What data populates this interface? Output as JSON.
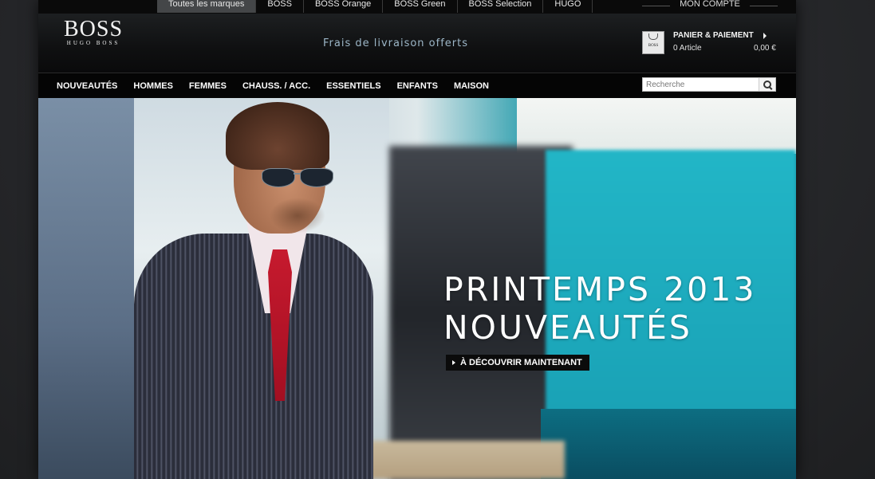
{
  "brand_tabs": [
    {
      "label": "Toutes les marques",
      "active": true
    },
    {
      "label": "BOSS",
      "active": false
    },
    {
      "label": "BOSS Orange",
      "active": false
    },
    {
      "label": "BOSS Green",
      "active": false
    },
    {
      "label": "BOSS Selection",
      "active": false
    },
    {
      "label": "HUGO",
      "active": false
    }
  ],
  "account": {
    "label": "MON COMPTE"
  },
  "logo": {
    "main": "BOSS",
    "sub": "HUGO BOSS"
  },
  "promo": {
    "text": "Frais de livraison offerts"
  },
  "cart": {
    "title": "PANIER & PAIEMENT",
    "count": "0 Article",
    "total": "0,00 €",
    "icon_label": "BOSS"
  },
  "nav": {
    "items": [
      "NOUVEAUTÉS",
      "HOMMES",
      "FEMMES",
      "CHAUSS. / ACC.",
      "ESSENTIELS",
      "ENFANTS",
      "MAISON"
    ]
  },
  "search": {
    "placeholder": "Recherche"
  },
  "hero": {
    "title_line1": "PRINTEMPS 2013",
    "title_line2": "NOUVEAUTÉS",
    "cta": "À DÉCOUVRIR MAINTENANT"
  },
  "colors": {
    "promo": "#9cb6c7",
    "tie": "#c61a2e",
    "teal": "#21a6b8"
  }
}
